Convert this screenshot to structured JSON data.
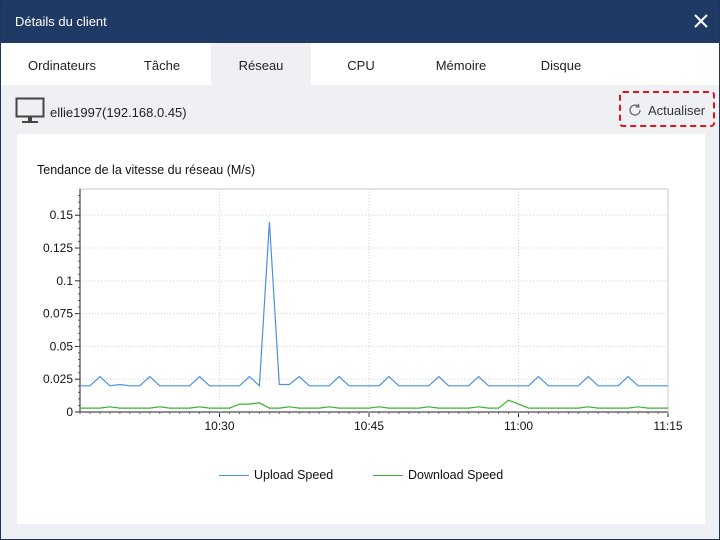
{
  "window": {
    "title": "Détails du client"
  },
  "tabs": [
    {
      "label": "Ordinateurs"
    },
    {
      "label": "Tâche"
    },
    {
      "label": "Réseau"
    },
    {
      "label": "CPU"
    },
    {
      "label": "Mémoire"
    },
    {
      "label": "Disque"
    }
  ],
  "active_tab": "Réseau",
  "client": {
    "name": "ellie1997(192.168.0.45)",
    "icon": "monitor-icon"
  },
  "refresh": {
    "label": "Actualiser",
    "icon": "refresh-icon"
  },
  "colors": {
    "titlebar": "#203a66",
    "upload": "#4a90e2",
    "download": "#3cb034",
    "highlight": "#e0141e"
  },
  "chart_data": {
    "type": "line",
    "title": "Tendance de la vitesse du réseau (M/s)",
    "xlabel": "",
    "ylabel": "",
    "ylim": [
      0,
      0.17
    ],
    "yticks": [
      "0",
      "0.025",
      "0.05",
      "0.075",
      "0.1",
      "0.125",
      "0.15"
    ],
    "xticks": [
      "10:30",
      "10:45",
      "11:00",
      "11:15"
    ],
    "grid": true,
    "legend_position": "bottom",
    "x": [
      "10:16",
      "10:17",
      "10:18",
      "10:19",
      "10:20",
      "10:21",
      "10:22",
      "10:23",
      "10:24",
      "10:25",
      "10:26",
      "10:27",
      "10:28",
      "10:29",
      "10:30",
      "10:31",
      "10:32",
      "10:33",
      "10:34",
      "10:35",
      "10:36",
      "10:37",
      "10:38",
      "10:39",
      "10:40",
      "10:41",
      "10:42",
      "10:43",
      "10:44",
      "10:45",
      "10:46",
      "10:47",
      "10:48",
      "10:49",
      "10:50",
      "10:51",
      "10:52",
      "10:53",
      "10:54",
      "10:55",
      "10:56",
      "10:57",
      "10:58",
      "10:59",
      "11:00",
      "11:01",
      "11:02",
      "11:03",
      "11:04",
      "11:05",
      "11:06",
      "11:07",
      "11:08",
      "11:09",
      "11:10",
      "11:11",
      "11:12",
      "11:13",
      "11:14",
      "11:15"
    ],
    "series": [
      {
        "name": "Upload Speed",
        "values": [
          0.02,
          0.02,
          0.027,
          0.02,
          0.021,
          0.02,
          0.02,
          0.027,
          0.02,
          0.02,
          0.02,
          0.02,
          0.027,
          0.02,
          0.02,
          0.02,
          0.02,
          0.027,
          0.02,
          0.145,
          0.021,
          0.021,
          0.027,
          0.02,
          0.02,
          0.02,
          0.027,
          0.02,
          0.02,
          0.02,
          0.02,
          0.027,
          0.02,
          0.02,
          0.02,
          0.02,
          0.027,
          0.02,
          0.02,
          0.02,
          0.027,
          0.02,
          0.02,
          0.02,
          0.02,
          0.02,
          0.027,
          0.02,
          0.02,
          0.02,
          0.02,
          0.027,
          0.02,
          0.02,
          0.02,
          0.027,
          0.02,
          0.02,
          0.02,
          0.02
        ]
      },
      {
        "name": "Download Speed",
        "values": [
          0.003,
          0.003,
          0.003,
          0.004,
          0.003,
          0.003,
          0.003,
          0.003,
          0.004,
          0.003,
          0.003,
          0.003,
          0.004,
          0.003,
          0.003,
          0.003,
          0.006,
          0.006,
          0.007,
          0.003,
          0.003,
          0.004,
          0.003,
          0.003,
          0.003,
          0.004,
          0.003,
          0.003,
          0.003,
          0.003,
          0.004,
          0.003,
          0.003,
          0.003,
          0.003,
          0.004,
          0.003,
          0.003,
          0.003,
          0.003,
          0.004,
          0.003,
          0.003,
          0.009,
          0.006,
          0.003,
          0.003,
          0.003,
          0.003,
          0.003,
          0.003,
          0.004,
          0.003,
          0.003,
          0.003,
          0.003,
          0.004,
          0.003,
          0.003,
          0.003
        ]
      }
    ]
  }
}
